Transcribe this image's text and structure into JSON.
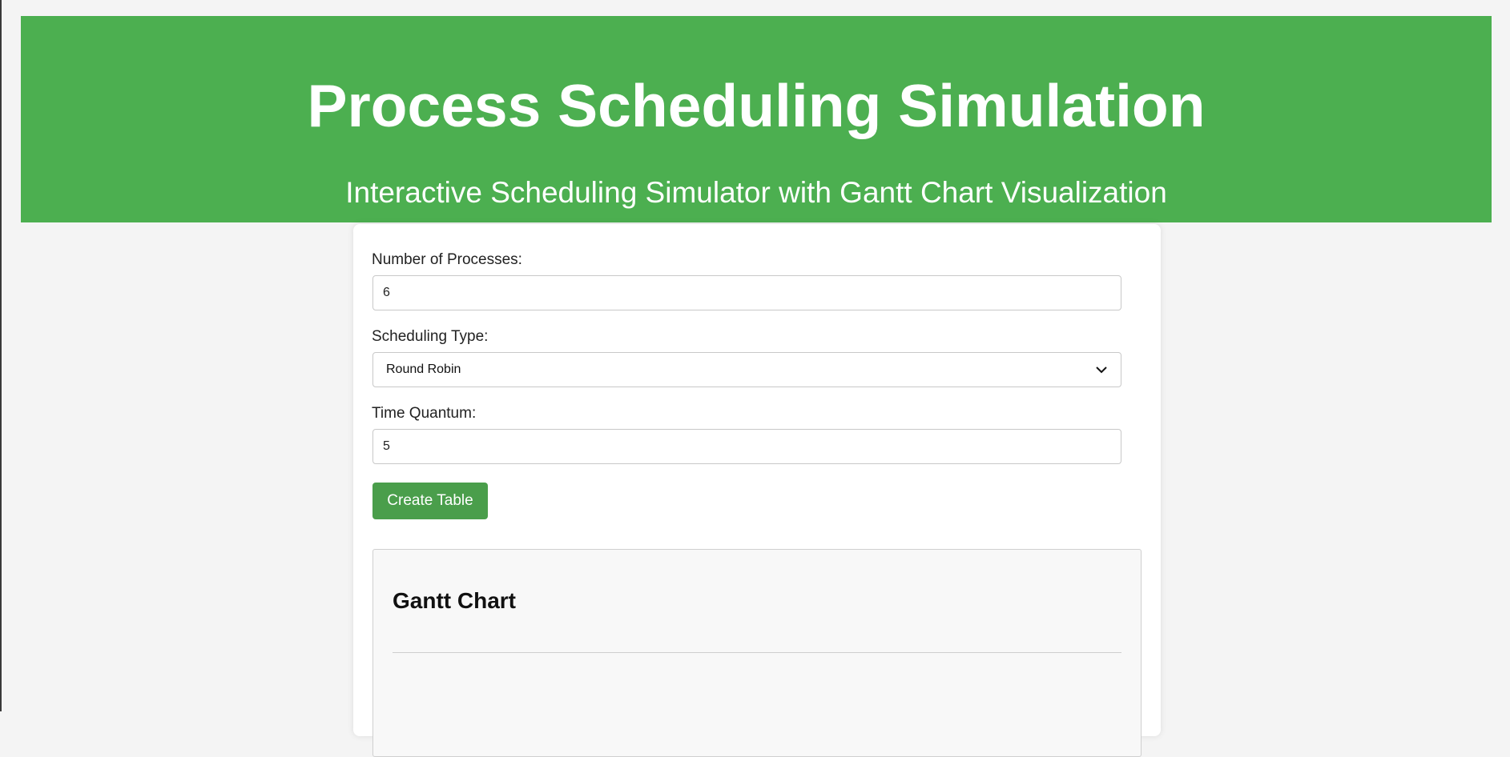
{
  "header": {
    "title": "Process Scheduling Simulation",
    "subtitle": "Interactive Scheduling Simulator with Gantt Chart Visualization"
  },
  "form": {
    "num_processes": {
      "label": "Number of Processes:",
      "value": "6"
    },
    "scheduling_type": {
      "label": "Scheduling Type:",
      "selected": "Round Robin"
    },
    "time_quantum": {
      "label": "Time Quantum:",
      "value": "5"
    },
    "create_button_label": "Create Table"
  },
  "gantt": {
    "title": "Gantt Chart"
  },
  "colors": {
    "header_bg": "#4caf50",
    "button_bg": "#4a9e4b",
    "page_bg": "#f4f4f4",
    "panel_bg": "#f8f8f8"
  },
  "icons": {
    "select_arrow": "chevron-down-icon"
  }
}
